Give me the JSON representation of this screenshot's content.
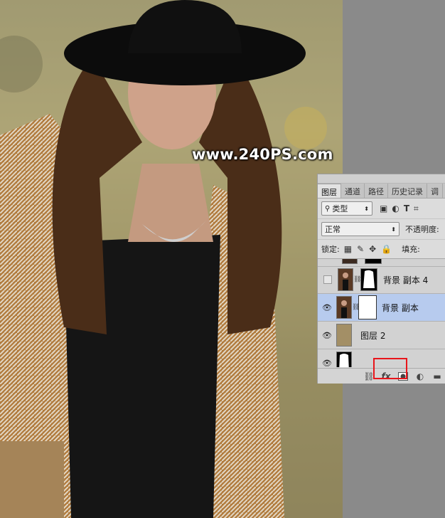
{
  "watermark": "www.240PS.com",
  "panel": {
    "tabs": [
      {
        "label": "图层",
        "active": true
      },
      {
        "label": "通道",
        "active": false
      },
      {
        "label": "路径",
        "active": false
      },
      {
        "label": "历史记录",
        "active": false
      },
      {
        "label": "调",
        "active": false
      }
    ],
    "filter": {
      "selected": "类型"
    },
    "blend_mode": {
      "selected": "正常"
    },
    "opacity_label": "不透明度:",
    "lock_label": "锁定:",
    "fill_label": "填充:",
    "layers": [
      {
        "name": "背景 副本 4",
        "visible": false,
        "selected": false
      },
      {
        "name": "背景 副本",
        "visible": true,
        "selected": true
      },
      {
        "name": "图层 2",
        "visible": true,
        "selected": false
      }
    ],
    "bottom_icons": [
      "link-icon",
      "fx-icon",
      "add-mask-icon",
      "adjustment-icon",
      "folder-icon"
    ]
  },
  "colors": {
    "highlight": "#e8151b",
    "selected_layer": "#b7cbee"
  }
}
